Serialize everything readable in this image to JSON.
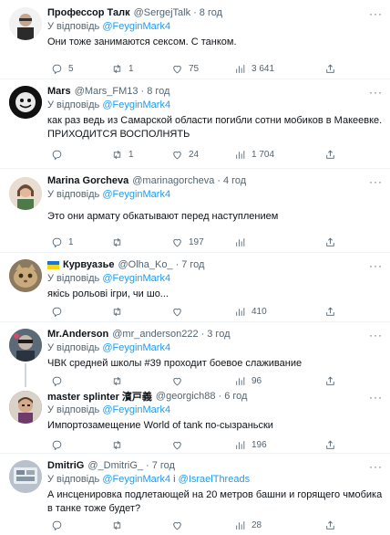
{
  "reply_prefix": "У відповідь",
  "tweets": [
    {
      "name": "Профессор Талк",
      "handle": "@SergejTalk",
      "time": "8 год",
      "reply_to": "@FeyginMark4",
      "text": "Они тоже занимаются сексом. С танком.",
      "replies": "5",
      "retweets": "1",
      "likes": "75",
      "views": "3 641",
      "avatar_color": "#e8e8e8"
    },
    {
      "name": "Mars",
      "handle": "@Mars_FM13",
      "time": "8 год",
      "reply_to": "@FeyginMark4",
      "text": "как раз ведь из Самарской области погибли сотни мобиков в Макеевке. ПРИХОДИТСЯ ВОСПОЛНЯТЬ",
      "replies": "",
      "retweets": "1",
      "likes": "24",
      "views": "1 704",
      "avatar_color": "#1a1a1a"
    },
    {
      "name": "Marina Gorcheva",
      "handle": "@marinagorcheva",
      "time": "4 год",
      "reply_to": "@FeyginMark4",
      "text": "Это они армату обкатывают перед наступлением",
      "replies": "1",
      "retweets": "",
      "likes": "197",
      "views": "",
      "avatar_color": "#d8c4b0"
    },
    {
      "name": "Курвуазье",
      "handle": "@Olha_Ko_",
      "time": "7 год",
      "reply_to": "@FeyginMark4",
      "text": "якісь рольові ігри, чи шо...",
      "replies": "",
      "retweets": "",
      "likes": "",
      "views": "410",
      "avatar_color": "#a89070"
    },
    {
      "name": "Mr.Anderson",
      "handle": "@mr_anderson222",
      "time": "3 год",
      "reply_to": "@FeyginMark4",
      "text": "ЧВК средней школы #39 проходит боевое слаживание",
      "replies": "",
      "retweets": "",
      "likes": "",
      "views": "96",
      "avatar_color": "#8a9aa8"
    },
    {
      "name": "master splinter 濱戸義",
      "handle": "@georgich88",
      "time": "6 год",
      "reply_to": "@FeyginMark4",
      "text": "Импортозамещение World of tank по-сызраньски",
      "replies": "",
      "retweets": "",
      "likes": "",
      "views": "196",
      "avatar_color": "#6a4a3a"
    },
    {
      "name": "DmitriG",
      "handle": "@_DmitriG_",
      "time": "7 год",
      "reply_to": "@FeyginMark4",
      "reply_conj": "і",
      "reply_to2": "@IsraelThreads",
      "text": "А инсценировка подлетающей на 20 метров башни и горящего чмобика в танке тоже будет?",
      "replies": "",
      "retweets": "",
      "likes": "",
      "views": "28",
      "avatar_color": "#c8c8d0"
    }
  ]
}
